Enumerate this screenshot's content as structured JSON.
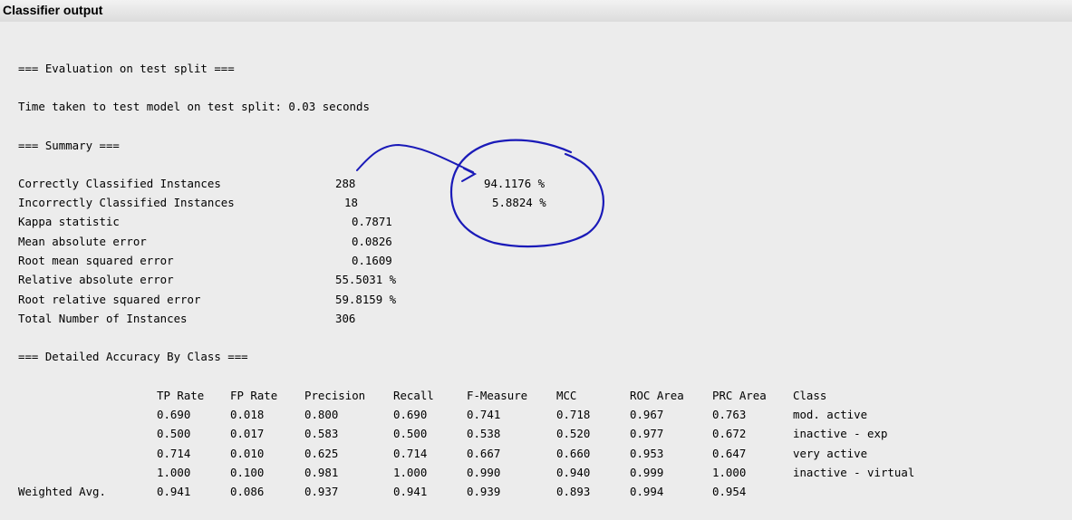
{
  "panel": {
    "title": "Classifier output"
  },
  "header": {
    "eval": "=== Evaluation on test split ===",
    "time": "Time taken to test model on test split: 0.03 seconds",
    "summary": "=== Summary ===",
    "detailed": "=== Detailed Accuracy By Class ==="
  },
  "summary": [
    {
      "label": "Correctly Classified Instances",
      "value": "288",
      "pct": "94.1176 %"
    },
    {
      "label": "Incorrectly Classified Instances",
      "value": "18",
      "pct": "5.8824 %"
    },
    {
      "label": "Kappa statistic",
      "value": "0.7871"
    },
    {
      "label": "Mean absolute error",
      "value": "0.0826"
    },
    {
      "label": "Root mean squared error",
      "value": "0.1609"
    },
    {
      "label": "Relative absolute error",
      "value": "55.5031 %"
    },
    {
      "label": "Root relative squared error",
      "value": "59.8159 %"
    },
    {
      "label": "Total Number of Instances",
      "value": "306"
    }
  ],
  "table": {
    "headers": [
      "TP Rate",
      "FP Rate",
      "Precision",
      "Recall",
      "F-Measure",
      "MCC",
      "ROC Area",
      "PRC Area",
      "Class"
    ],
    "rows": [
      {
        "label": "",
        "cells": [
          "0.690",
          "0.018",
          "0.800",
          "0.690",
          "0.741",
          "0.718",
          "0.967",
          "0.763",
          "mod. active"
        ]
      },
      {
        "label": "",
        "cells": [
          "0.500",
          "0.017",
          "0.583",
          "0.500",
          "0.538",
          "0.520",
          "0.977",
          "0.672",
          "inactive - exp"
        ]
      },
      {
        "label": "",
        "cells": [
          "0.714",
          "0.010",
          "0.625",
          "0.714",
          "0.667",
          "0.660",
          "0.953",
          "0.647",
          "very active"
        ]
      },
      {
        "label": "",
        "cells": [
          "1.000",
          "0.100",
          "0.981",
          "1.000",
          "0.990",
          "0.940",
          "0.999",
          "1.000",
          "inactive - virtual"
        ]
      },
      {
        "label": "Weighted Avg.",
        "cells": [
          "0.941",
          "0.086",
          "0.937",
          "0.941",
          "0.939",
          "0.893",
          "0.994",
          "0.954",
          ""
        ]
      }
    ]
  },
  "colors": {
    "annotation": "#1a1ab8"
  }
}
